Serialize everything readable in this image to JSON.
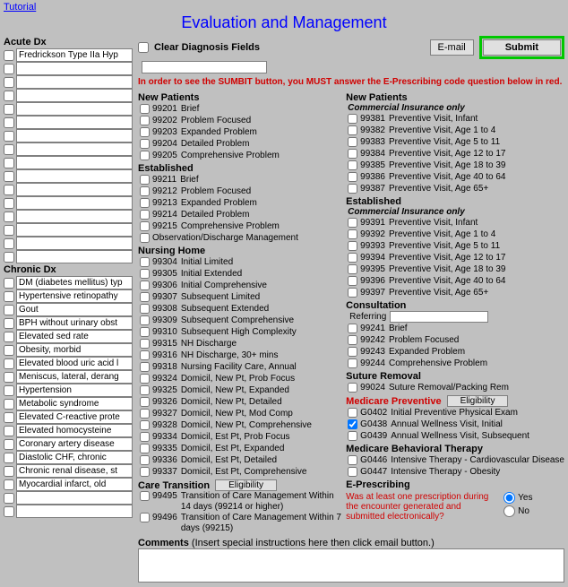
{
  "tutorial": "Tutorial",
  "title": "Evaluation and Management",
  "acute_label": "Acute Dx",
  "chronic_label": "Chronic Dx",
  "acute_values": [
    "Fredrickson Type IIa Hyp",
    "",
    "",
    "",
    "",
    "",
    "",
    "",
    "",
    "",
    "",
    "",
    "",
    "",
    "",
    ""
  ],
  "chronic_values": [
    "DM (diabetes mellitus) typ",
    "Hypertensive retinopathy",
    "Gout",
    "BPH without urinary obst",
    "Elevated sed rate",
    "Obesity, morbid",
    "Elevated blood uric acid l",
    "Meniscus, lateral, derang",
    "Hypertension",
    "Metabolic syndrome",
    "Elevated C-reactive prote",
    "Elevated homocysteine",
    "Coronary artery disease",
    "Diastolic CHF, chronic",
    "Chronic renal disease, st",
    "Myocardial infarct, old",
    "",
    ""
  ],
  "clear_label": "Clear Diagnosis Fields",
  "email_btn": "E-mail",
  "submit_btn": "Submit",
  "warning": "In order to see the SUMBIT button, you MUST answer the E-Prescribing code question below in red.",
  "left": {
    "new_patients": "New Patients",
    "new_codes": [
      {
        "c": "99201",
        "t": "Brief"
      },
      {
        "c": "99202",
        "t": "Problem Focused"
      },
      {
        "c": "99203",
        "t": "Expanded Problem"
      },
      {
        "c": "99204",
        "t": "Detailed Problem"
      },
      {
        "c": "99205",
        "t": "Comprehensive Problem"
      }
    ],
    "established": "Established",
    "est_codes": [
      {
        "c": "99211",
        "t": "Brief"
      },
      {
        "c": "99212",
        "t": "Problem Focused"
      },
      {
        "c": "99213",
        "t": "Expanded Problem"
      },
      {
        "c": "99214",
        "t": "Detailed Problem"
      },
      {
        "c": "99215",
        "t": "Comprehensive Problem"
      },
      {
        "c": "",
        "t": "Observation/Discharge Management"
      }
    ],
    "nursing": "Nursing Home",
    "nursing_codes": [
      {
        "c": "99304",
        "t": "Initial Limited"
      },
      {
        "c": "99305",
        "t": "Initial Extended"
      },
      {
        "c": "99306",
        "t": "Initial Comprehensive"
      },
      {
        "c": "99307",
        "t": "Subsequent Limited"
      },
      {
        "c": "99308",
        "t": "Subsequent Extended"
      },
      {
        "c": "99309",
        "t": "Subsequent Comprehensive"
      },
      {
        "c": "99310",
        "t": "Subsequent High Complexity"
      },
      {
        "c": "99315",
        "t": "NH Discharge"
      },
      {
        "c": "99316",
        "t": "NH Discharge, 30+ mins"
      },
      {
        "c": "99318",
        "t": "Nursing Facility Care, Annual"
      },
      {
        "c": "99324",
        "t": "Domicil, New Pt, Prob Focus"
      },
      {
        "c": "99325",
        "t": "Domicil, New Pt, Expanded"
      },
      {
        "c": "99326",
        "t": "Domicil, New Pt, Detailed"
      },
      {
        "c": "99327",
        "t": "Domicil, New Pt, Mod Comp"
      },
      {
        "c": "99328",
        "t": "Domicil, New Pt, Comprehensive"
      },
      {
        "c": "99334",
        "t": "Domicil, Est Pt, Prob Focus"
      },
      {
        "c": "99335",
        "t": "Domicil, Est Pt, Expanded"
      },
      {
        "c": "99336",
        "t": "Domicil, Est Pt, Detailed"
      },
      {
        "c": "99337",
        "t": "Domicil, Est Pt, Comprehensive"
      }
    ],
    "care_transition": "Care Transition",
    "eligibility": "Eligibility",
    "care_codes": [
      {
        "c": "99495",
        "t": "Transition of Care Management Within 14 days (99214 or higher)"
      },
      {
        "c": "99496",
        "t": "Transition of Care Management Within 7 days (99215)"
      }
    ]
  },
  "right": {
    "new_patients": "New Patients",
    "commercial": "Commercial Insurance only",
    "new_codes": [
      {
        "c": "99381",
        "t": "Preventive Visit, Infant"
      },
      {
        "c": "99382",
        "t": "Preventive Visit, Age 1 to 4"
      },
      {
        "c": "99383",
        "t": "Preventive Visit, Age 5 to 11"
      },
      {
        "c": "99384",
        "t": "Preventive Visit, Age 12 to 17"
      },
      {
        "c": "99385",
        "t": "Preventive Visit, Age 18 to 39"
      },
      {
        "c": "99386",
        "t": "Preventive Visit, Age 40 to 64"
      },
      {
        "c": "99387",
        "t": "Preventive Visit, Age 65+"
      }
    ],
    "established": "Established",
    "est_codes": [
      {
        "c": "99391",
        "t": "Preventive Visit, Infant"
      },
      {
        "c": "99392",
        "t": "Preventive Visit, Age 1 to 4"
      },
      {
        "c": "99393",
        "t": "Preventive Visit, Age 5 to 11"
      },
      {
        "c": "99394",
        "t": "Preventive Visit, Age 12 to 17"
      },
      {
        "c": "99395",
        "t": "Preventive Visit, Age 18 to 39"
      },
      {
        "c": "99396",
        "t": "Preventive Visit, Age 40 to 64"
      },
      {
        "c": "99397",
        "t": "Preventive Visit, Age 65+"
      }
    ],
    "consultation": "Consultation",
    "referring": "Referring",
    "consult_codes": [
      {
        "c": "99241",
        "t": "Brief"
      },
      {
        "c": "99242",
        "t": "Problem Focused"
      },
      {
        "c": "99243",
        "t": "Expanded Problem"
      },
      {
        "c": "99244",
        "t": "Comprehensive Problem"
      }
    ],
    "suture": "Suture Removal",
    "suture_codes": [
      {
        "c": "99024",
        "t": "Suture Removal/Packing Rem"
      }
    ],
    "medicare_prev": "Medicare Preventive",
    "eligibility": "Eligibility",
    "medprev_codes": [
      {
        "c": "G0402",
        "t": "Initial Preventive Physical Exam",
        "ck": false
      },
      {
        "c": "G0438",
        "t": "Annual Wellness Visit, Initial",
        "ck": true
      },
      {
        "c": "G0439",
        "t": "Annual Wellness Visit, Subsequent",
        "ck": false
      }
    ],
    "medicare_beh": "Medicare Behavioral Therapy",
    "medbeh_codes": [
      {
        "c": "G0446",
        "t": "Intensive Therapy - Cardiovascular Disease"
      },
      {
        "c": "G0447",
        "t": "Intensive Therapy - Obesity"
      }
    ],
    "eprescribe_h": "E-Prescribing",
    "eprescribe_q": "Was at least one prescription during the encounter generated and submitted electronically?",
    "yes": "Yes",
    "no": "No"
  },
  "comments_label": "Comments",
  "comments_sub": "(Insert special instructions here then click email button.)"
}
